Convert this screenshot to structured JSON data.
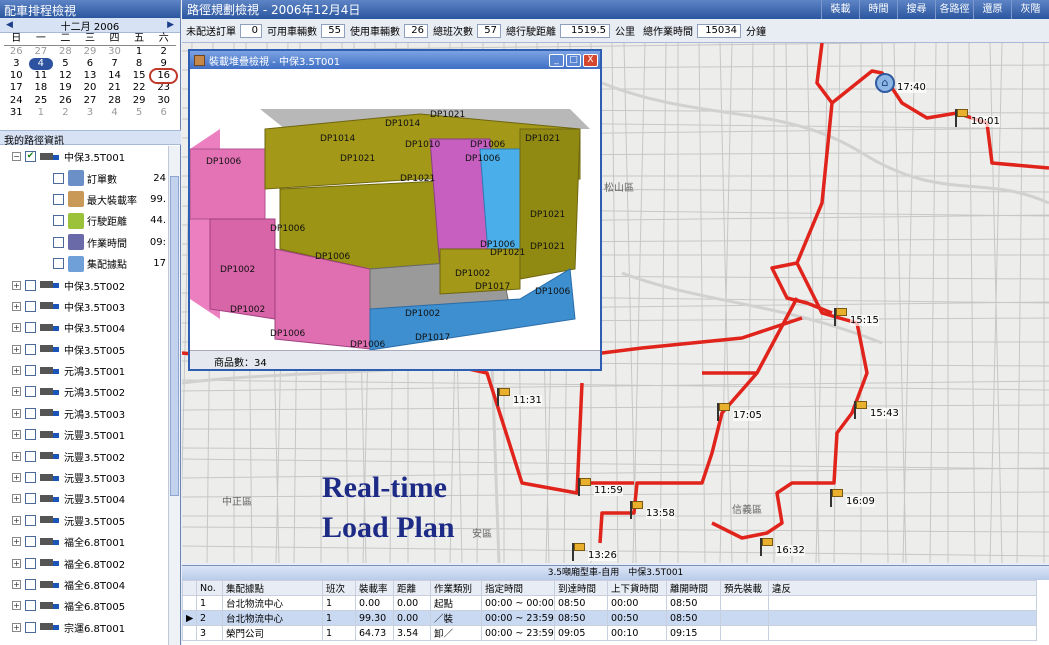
{
  "left": {
    "title": "配車排程檢視",
    "calendar": {
      "month_label": "十二月 2006",
      "prev": "◀",
      "next": "▶",
      "dow": [
        "日",
        "一",
        "二",
        "三",
        "四",
        "五",
        "六"
      ],
      "weeks": [
        [
          "26",
          "27",
          "28",
          "29",
          "30",
          "1",
          "2"
        ],
        [
          "3",
          "4",
          "5",
          "6",
          "7",
          "8",
          "9"
        ],
        [
          "10",
          "11",
          "12",
          "13",
          "14",
          "15",
          "16"
        ],
        [
          "17",
          "18",
          "19",
          "20",
          "21",
          "22",
          "23"
        ],
        [
          "24",
          "25",
          "26",
          "27",
          "28",
          "29",
          "30"
        ],
        [
          "31",
          "1",
          "2",
          "3",
          "4",
          "5",
          "6"
        ]
      ]
    },
    "section_title": "我的路徑資訊",
    "expanded": {
      "name": "中保3.5T001",
      "details": [
        {
          "label": "訂單數",
          "value": "24",
          "icon": "order-icon"
        },
        {
          "label": "最大裝載率",
          "value": "99.",
          "icon": "box-icon"
        },
        {
          "label": "行駛距離",
          "value": "44.",
          "icon": "distance-icon"
        },
        {
          "label": "作業時間",
          "value": "09:",
          "icon": "worker-icon"
        },
        {
          "label": "集配據點",
          "value": "17",
          "icon": "location-icon"
        }
      ]
    },
    "vehicles": [
      "中保3.5T002",
      "中保3.5T003",
      "中保3.5T004",
      "中保3.5T005",
      "元鴻3.5T001",
      "元鴻3.5T002",
      "元鴻3.5T003",
      "沅豐3.5T001",
      "沅豐3.5T002",
      "沅豐3.5T003",
      "沅豐3.5T004",
      "沅豐3.5T005",
      "福全6.8T001",
      "福全6.8T002",
      "福全6.8T004",
      "福全6.8T005",
      "宗運6.8T001"
    ]
  },
  "top": {
    "title": "路徑規劃檢視 - 2006年12月4日",
    "buttons": [
      "裝載",
      "時間",
      "搜尋",
      "各路徑",
      "還原",
      "灰階"
    ]
  },
  "stats": {
    "unassigned_label": "未配送訂單",
    "unassigned": "0",
    "avail_label": "可用車輛數",
    "avail": "55",
    "used_label": "使用車輛數",
    "used": "26",
    "trips_label": "總班次數",
    "trips": "57",
    "dist_label": "總行駛距離",
    "dist": "1519.5",
    "dist_unit": "公里",
    "time_label": "總作業時間",
    "time": "15034",
    "time_unit": "分鐘"
  },
  "map": {
    "overlay_line1": "Real-time",
    "overlay_line2": "Load Plan",
    "districts": [
      "松山區",
      "中正區",
      "信義區",
      "安區"
    ],
    "stops": [
      {
        "time": "17:40",
        "kind": "home"
      },
      {
        "time": "10:01"
      },
      {
        "time": "15:15"
      },
      {
        "time": "15:43"
      },
      {
        "time": "17:05"
      },
      {
        "time": "11:31"
      },
      {
        "time": "11:59"
      },
      {
        "time": "13:58"
      },
      {
        "time": "16:09"
      },
      {
        "time": "13:26"
      },
      {
        "time": "16:32"
      }
    ]
  },
  "popup": {
    "title": "裝載堆疊檢視 - 中保3.5T001",
    "min": "_",
    "max": "□",
    "close": "X",
    "status": "商品數：34",
    "labels": [
      "DP1014",
      "DP1021",
      "DP1006",
      "DP1010",
      "DP1014",
      "DP1006",
      "DP1021",
      "DP1006",
      "DP1021",
      "DP1021",
      "DP1006",
      "DP1021",
      "DP1006",
      "DP1006",
      "DP1021",
      "DP1002",
      "DP1002",
      "DP1017",
      "DP1002",
      "DP1002",
      "DP1006",
      "DP1017",
      "DP1006",
      "DP1021",
      "DP1006"
    ]
  },
  "bottom": {
    "title": "3.5噸廂型車-自用　中保3.5T001",
    "columns": [
      "No.",
      "集配據點",
      "班次",
      "裝載率",
      "距離",
      "作業類別",
      "指定時間",
      "到達時間",
      "上下貨時間",
      "離開時間",
      "預先裝載",
      "違反"
    ],
    "rows": [
      [
        "",
        "1",
        "台北物流中心",
        "1",
        "0.00",
        "0.00",
        "起點",
        "00:00 ~ 00:00",
        "08:50",
        "00:00",
        "08:50",
        "",
        ""
      ],
      [
        "▶",
        "2",
        "台北物流中心",
        "1",
        "99.30",
        "0.00",
        "／裝",
        "00:00 ~ 23:59",
        "08:50",
        "00:50",
        "08:50",
        "",
        ""
      ],
      [
        "",
        "3",
        "榮門公司",
        "1",
        "64.73",
        "3.54",
        "卸／",
        "00:00 ~ 23:59",
        "09:05",
        "00:10",
        "09:15",
        "",
        ""
      ]
    ]
  }
}
